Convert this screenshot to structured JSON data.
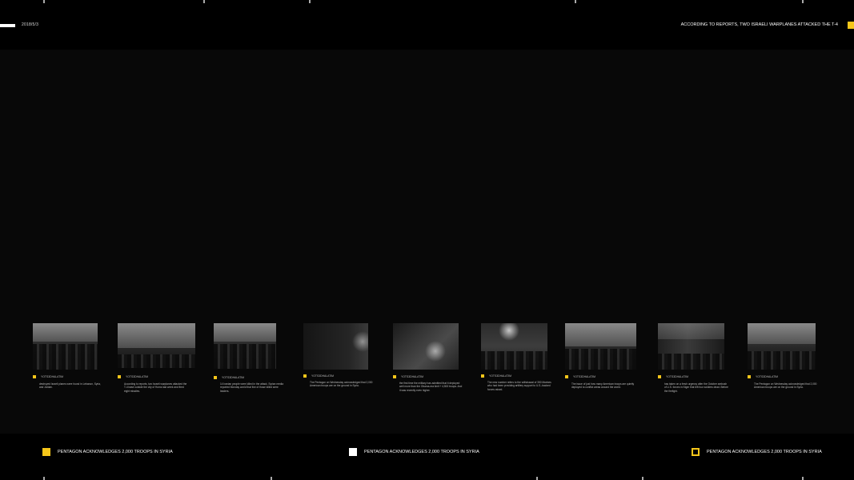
{
  "header": {
    "date": "2018/5/3",
    "headline": "ACCORDING TO REPORTS, TWO ISRAELI WARPLANES ATTACKED THE T-4",
    "accent": "#f6c61a"
  },
  "cards": [
    {
      "tag": "YOTS3DHALATIM",
      "caption": "destroyed Israeli planes were found in Lebanon, Syria, and Jordan."
    },
    {
      "tag": "YOTS3DHALATIM",
      "caption": "According to reports, two Israeli warplanes attacked the T-4 base outside the city of Homs last week and fired eight missiles."
    },
    {
      "tag": "YOTS3DHALATIM",
      "caption": "14 Iranian people were killed in the attack. Syrian media reported Monday world that five of those killed were leaders."
    },
    {
      "tag": "YOTS3DHALATIM",
      "caption": "The Pentagon on Wednesday acknowledged that 2,000 American troops are on the ground in Syria."
    },
    {
      "tag": "YOTS3DHALATIM",
      "caption": "the first time the military has admitted that it deployed well more than the Obama-era limit + 4,500 troops. And it was recently even higher."
    },
    {
      "tag": "YOTS3DHALATIM",
      "caption": "The new number refers to the withdrawal of 350 Marines who had been providing artillery support to U.S.-backed forces raised."
    },
    {
      "tag": "YOTS3DHALATIM",
      "caption": "The issue of just how many American troops are quietly deployed to conflict areas around the world."
    },
    {
      "tag": "YOTS3DHALATIM",
      "caption": "has taken on a fresh urgency after the October ambush of U.S. forces in Niger that left four soldiers dead. Before the firefight."
    },
    {
      "tag": "YOTS3DHALATIM",
      "caption": "The Pentagon on Wednesday acknowledged that 2,000 American troops are on the ground in Syria."
    }
  ],
  "ticker": [
    {
      "text": "PENTAGON ACKNOWLEDGES 2,000 TROOPS IN SYRIA"
    },
    {
      "text": "PENTAGON ACKNOWLEDGES 2,000 TROOPS IN SYRIA"
    },
    {
      "text": "PENTAGON ACKNOWLEDGES 2,000 TROOPS IN SYRIA"
    }
  ]
}
